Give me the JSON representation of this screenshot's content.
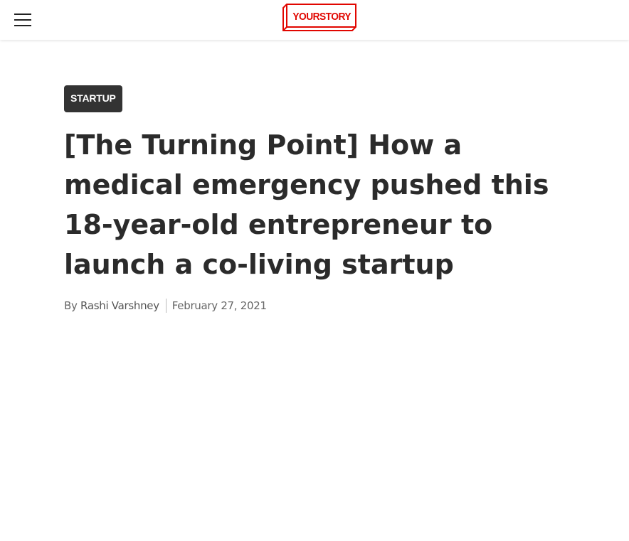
{
  "header": {
    "menu_icon": "hamburger-menu-icon",
    "logo_text": "YOURSTORY",
    "logo_color": "#e10600"
  },
  "article": {
    "category": "STARTUP",
    "title": "[The Turning Point] How a medical emergency pushed this 18-year-old entrepreneur to launch a co-living startup",
    "byline_prefix": "By",
    "author": "Rashi Varshney",
    "date": "February 27, 2021"
  },
  "colors": {
    "tag_bg": "#333333",
    "headline": "#2b2b2b",
    "meta_text": "#666666"
  }
}
